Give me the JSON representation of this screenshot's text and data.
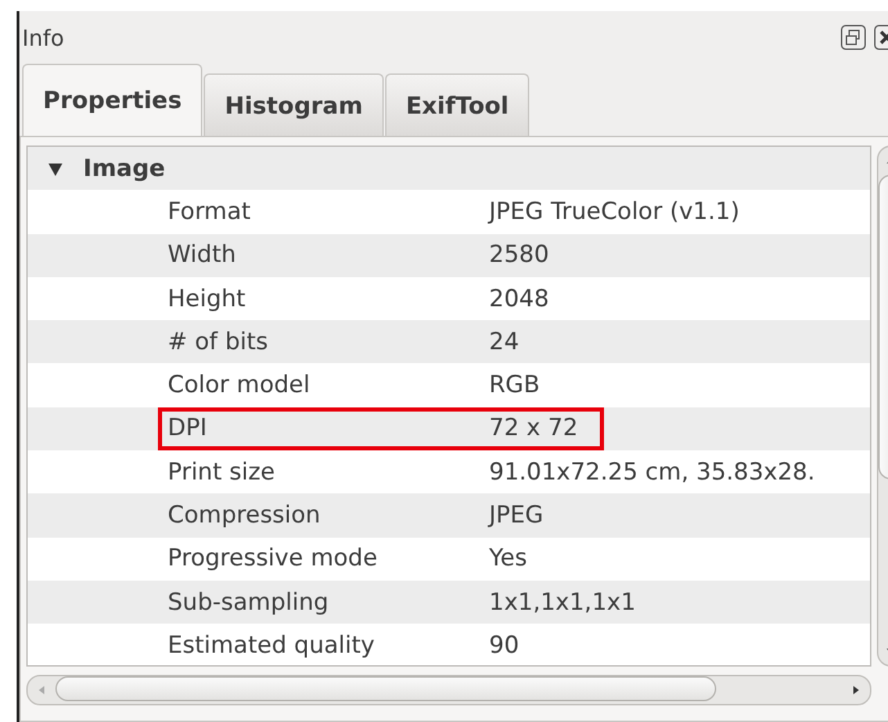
{
  "panel": {
    "title": "Info"
  },
  "tabs": [
    {
      "label": "Properties",
      "selected": true
    },
    {
      "label": "Histogram",
      "selected": false
    },
    {
      "label": "ExifTool",
      "selected": false
    }
  ],
  "tree": {
    "group": {
      "label": "Image",
      "expanded": true
    },
    "rows": [
      {
        "name": "Format",
        "value": "JPEG TrueColor (v1.1)",
        "highlighted": false
      },
      {
        "name": "Width",
        "value": "2580",
        "highlighted": false
      },
      {
        "name": "Height",
        "value": "2048",
        "highlighted": false
      },
      {
        "name": "# of bits",
        "value": "24",
        "highlighted": false
      },
      {
        "name": "Color model",
        "value": "RGB",
        "highlighted": false
      },
      {
        "name": "DPI",
        "value": "72 x 72",
        "highlighted": true
      },
      {
        "name": "Print size",
        "value": "91.01x72.25 cm, 35.83x28.",
        "highlighted": false
      },
      {
        "name": "Compression",
        "value": "JPEG",
        "highlighted": false
      },
      {
        "name": "Progressive mode",
        "value": "Yes",
        "highlighted": false
      },
      {
        "name": "Sub-sampling",
        "value": "1x1,1x1,1x1",
        "highlighted": false
      },
      {
        "name": "Estimated quality",
        "value": "90",
        "highlighted": false
      }
    ]
  }
}
